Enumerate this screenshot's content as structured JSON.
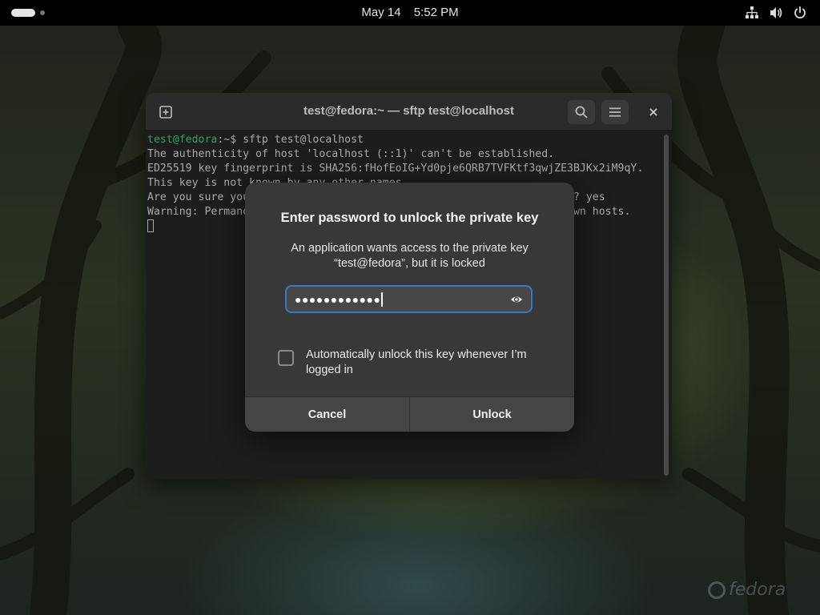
{
  "topbar": {
    "date": "May 14",
    "time": "5:52 PM",
    "tray_icons": [
      "network-icon",
      "volume-icon",
      "power-icon"
    ]
  },
  "wallpaper": {
    "logo_text": "fedora"
  },
  "terminal": {
    "title": "test@fedora:~ — sftp test@localhost",
    "prompt_user": "test@fedora",
    "prompt_rest": ":~$ sftp test@localhost",
    "lines": [
      "The authenticity of host 'localhost (::1)' can't be established.",
      "ED25519 key fingerprint is SHA256:fHofEoIG+Yd0pje6QRB7TVFKtf3qwjZE3BJKx2iM9qY.",
      "This key is not known by any other names",
      "Are you sure you want to continue connecting (yes/no/[fingerprint])? yes",
      "Warning: Permanently added 'localhost' (ED25519) to the list of known hosts."
    ]
  },
  "dialog": {
    "title": "Enter password to unlock the private key",
    "message_line1": "An application wants access to the private key",
    "message_line2": "“test@fedora”, but it is locked",
    "password_masked": "●●●●●●●●●●●●",
    "checkbox_label": "Automatically unlock this key whenever I’m logged in",
    "checkbox_checked": false,
    "cancel_label": "Cancel",
    "unlock_label": "Unlock"
  },
  "colors": {
    "accent_focus": "#3d75c6",
    "dialog_bg": "#383838",
    "prompt_green": "#26a269"
  }
}
